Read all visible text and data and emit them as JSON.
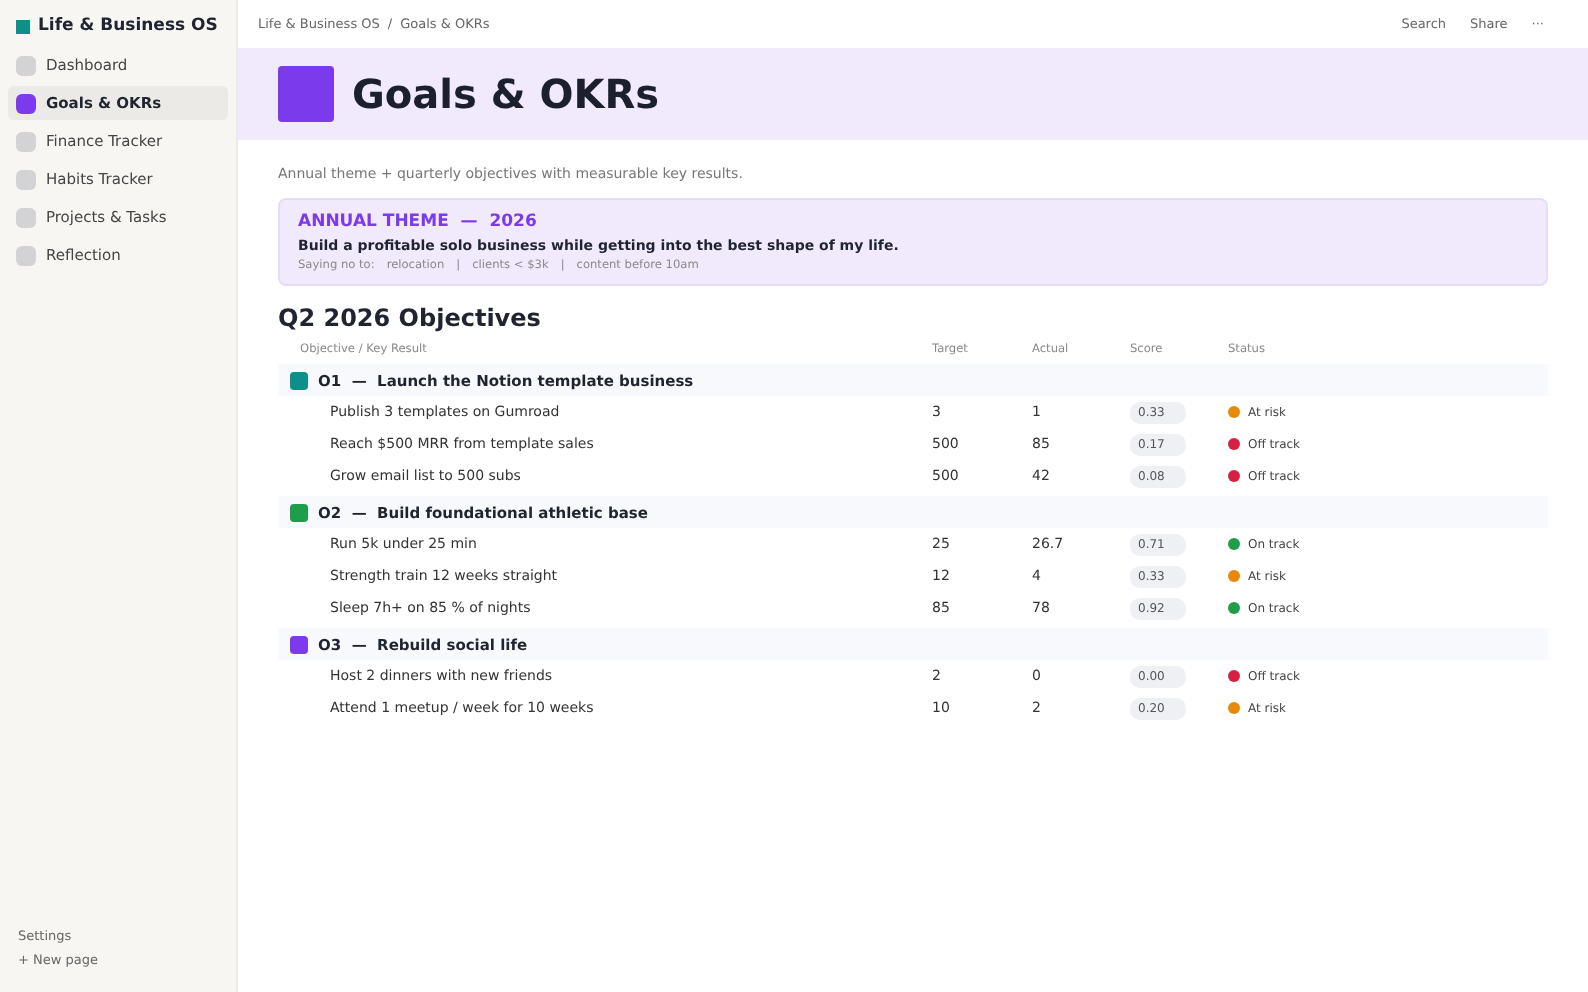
{
  "workspace": {
    "title": "Life & Business OS"
  },
  "sidebar": {
    "items": [
      {
        "label": "Dashboard",
        "selected": false,
        "color": "#d3d3d6"
      },
      {
        "label": "Goals & OKRs",
        "selected": true,
        "color": "#7c3aed"
      },
      {
        "label": "Finance Tracker",
        "selected": false,
        "color": "#d3d3d6"
      },
      {
        "label": "Habits Tracker",
        "selected": false,
        "color": "#d3d3d6"
      },
      {
        "label": "Projects & Tasks",
        "selected": false,
        "color": "#d3d3d6"
      },
      {
        "label": "Reflection",
        "selected": false,
        "color": "#d3d3d6"
      }
    ],
    "footer": [
      "Settings",
      "+  New page"
    ]
  },
  "breadcrumb": [
    "Life & Business OS",
    "/",
    "Goals & OKRs"
  ],
  "top_actions": [
    "Search",
    "Share",
    "···"
  ],
  "page": {
    "title": "Goals & OKRs",
    "description": "Annual theme + quarterly objectives with measurable key results."
  },
  "theme": {
    "heading": "ANNUAL THEME  —  2026",
    "statement": "Build a profitable solo business while getting into the best shape of my life.",
    "saying_no": [
      "Saying no to:",
      "relocation",
      "|",
      "clients < $3k",
      "|",
      "content before 10am"
    ]
  },
  "objectives_title": "Q2 2026 Objectives",
  "table": {
    "columns": [
      "Objective / Key Result",
      "Target",
      "Actual",
      "Score",
      "Status"
    ],
    "objectives": [
      {
        "title": "O1  —  Launch the Notion template business",
        "color": "#0f8f8a",
        "key_results": [
          {
            "name": "Publish 3 templates on Gumroad",
            "target": "3",
            "actual": "1",
            "score": "0.33",
            "status": "At risk",
            "color": "#e8890c"
          },
          {
            "name": "Reach $500 MRR from template sales",
            "target": "500",
            "actual": "85",
            "score": "0.17",
            "status": "Off track",
            "color": "#d61f45"
          },
          {
            "name": "Grow email list to 500 subs",
            "target": "500",
            "actual": "42",
            "score": "0.08",
            "status": "Off track",
            "color": "#d61f45"
          }
        ]
      },
      {
        "title": "O2  —  Build foundational athletic base",
        "color": "#1e9e4a",
        "key_results": [
          {
            "name": "Run 5k under 25 min",
            "target": "25",
            "actual": "26.7",
            "score": "0.71",
            "status": "On track",
            "color": "#1e9e4a"
          },
          {
            "name": "Strength train 12 weeks straight",
            "target": "12",
            "actual": "4",
            "score": "0.33",
            "status": "At risk",
            "color": "#e8890c"
          },
          {
            "name": "Sleep 7h+ on 85 % of nights",
            "target": "85",
            "actual": "78",
            "score": "0.92",
            "status": "On track",
            "color": "#1e9e4a"
          }
        ]
      },
      {
        "title": "O3  —  Rebuild social life",
        "color": "#7c3aed",
        "key_results": [
          {
            "name": "Host 2 dinners with new friends",
            "target": "2",
            "actual": "0",
            "score": "0.00",
            "status": "Off track",
            "color": "#d61f45"
          },
          {
            "name": "Attend 1 meetup / week for 10 weeks",
            "target": "10",
            "actual": "2",
            "score": "0.20",
            "status": "At risk",
            "color": "#e8890c"
          }
        ]
      }
    ]
  }
}
